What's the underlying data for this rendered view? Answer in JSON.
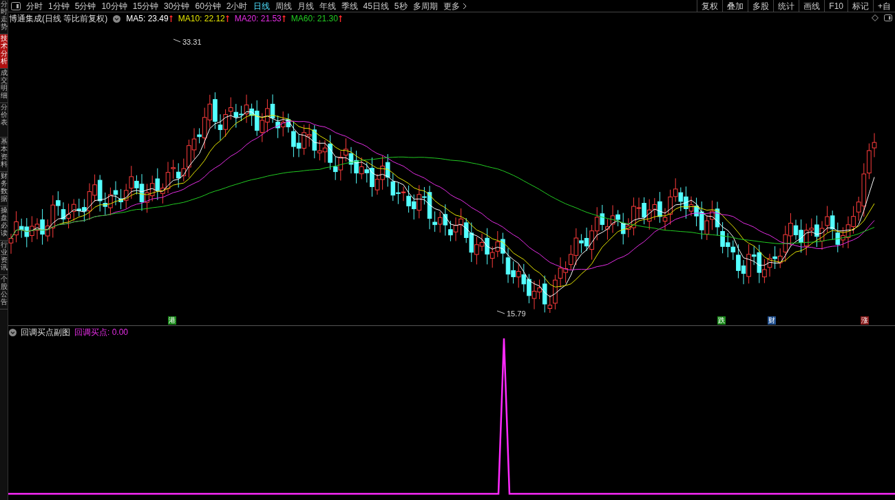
{
  "toolbar": {
    "periods": [
      {
        "label": "分时",
        "selected": false
      },
      {
        "label": "1分钟",
        "selected": false
      },
      {
        "label": "5分钟",
        "selected": false
      },
      {
        "label": "10分钟",
        "selected": false
      },
      {
        "label": "15分钟",
        "selected": false
      },
      {
        "label": "30分钟",
        "selected": false
      },
      {
        "label": "60分钟",
        "selected": false
      },
      {
        "label": "2小时",
        "selected": false
      },
      {
        "label": "日线",
        "selected": true
      },
      {
        "label": "周线",
        "selected": false
      },
      {
        "label": "月线",
        "selected": false
      },
      {
        "label": "年线",
        "selected": false
      },
      {
        "label": "季线",
        "selected": false
      },
      {
        "label": "45日线",
        "selected": false
      },
      {
        "label": "5秒",
        "selected": false
      },
      {
        "label": "多周期",
        "selected": false
      }
    ],
    "more": "更多",
    "tools": [
      "复权",
      "叠加",
      "多股",
      "统计",
      "画线",
      "F10",
      "标记",
      "+自"
    ]
  },
  "sidebar": {
    "tabs": [
      {
        "label": "分时走势",
        "selected": false
      },
      {
        "label": "技术分析",
        "selected": true
      },
      {
        "label": "成交明细",
        "selected": false
      },
      {
        "label": "分价表",
        "selected": false
      },
      {
        "label": "基本资料",
        "selected": false
      },
      {
        "label": "财务数据",
        "selected": false
      },
      {
        "label": "操盘必读",
        "selected": false
      },
      {
        "label": "行业资讯",
        "selected": false
      },
      {
        "label": "个股公告",
        "selected": false
      }
    ]
  },
  "main_chart": {
    "title": "博通集成(日线 等比前复权)",
    "ma": [
      {
        "label": "MA5: 23.49",
        "color": "#ffffff"
      },
      {
        "label": "MA10: 22.12",
        "color": "#e6e600"
      },
      {
        "label": "MA20: 21.53",
        "color": "#e62ee6"
      },
      {
        "label": "MA60: 21.30",
        "color": "#22cc22"
      }
    ],
    "high_label": "33.31",
    "low_label": "15.79",
    "markers": [
      {
        "label": "港",
        "color": "#1a8a1a"
      },
      {
        "label": "跌",
        "color": "#1a8a1a"
      },
      {
        "label": "财",
        "color": "#1f4f8f"
      },
      {
        "label": "涨",
        "color": "#8a1a1a"
      }
    ]
  },
  "sub_chart": {
    "title": "回调买点副图",
    "reading": "回调买点: 0.00"
  }
}
